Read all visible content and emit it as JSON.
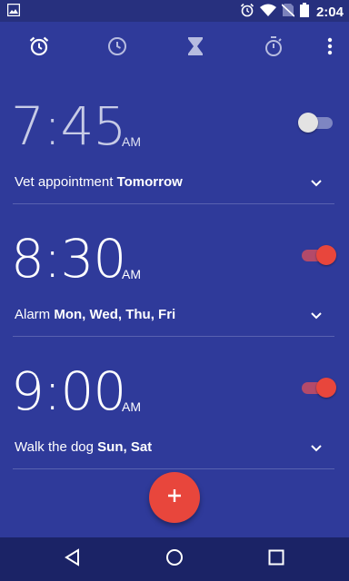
{
  "status_bar": {
    "time": "2:04",
    "icons": [
      "image-icon",
      "alarm-status-icon",
      "wifi-icon",
      "no-sim-icon",
      "battery-icon"
    ]
  },
  "toolbar": {
    "tabs": [
      {
        "name": "alarm",
        "icon": "alarm-clock-icon",
        "active": true
      },
      {
        "name": "clock",
        "icon": "clock-icon",
        "active": false
      },
      {
        "name": "timer",
        "icon": "hourglass-icon",
        "active": false
      },
      {
        "name": "stopwatch",
        "icon": "stopwatch-icon",
        "active": false
      }
    ],
    "more_icon": "more-vert-icon"
  },
  "alarms": [
    {
      "time": "7:45",
      "ampm": "AM",
      "label": "Vet appointment",
      "days": "Tomorrow",
      "enabled": false
    },
    {
      "time": "8:30",
      "ampm": "AM",
      "label": "Alarm",
      "days": "Mon, Wed, Thu, Fri",
      "enabled": true
    },
    {
      "time": "9:00",
      "ampm": "AM",
      "label": "Walk the dog",
      "days": "Sun, Sat",
      "enabled": true
    }
  ],
  "fab": {
    "icon": "add-icon"
  },
  "nav_bar": {
    "icons": [
      "back-icon",
      "home-icon",
      "recents-icon"
    ]
  },
  "colors": {
    "background": "#2f3a9a",
    "status_bar": "#27307e",
    "accent": "#e8463c",
    "nav_bar": "#1b2366"
  }
}
